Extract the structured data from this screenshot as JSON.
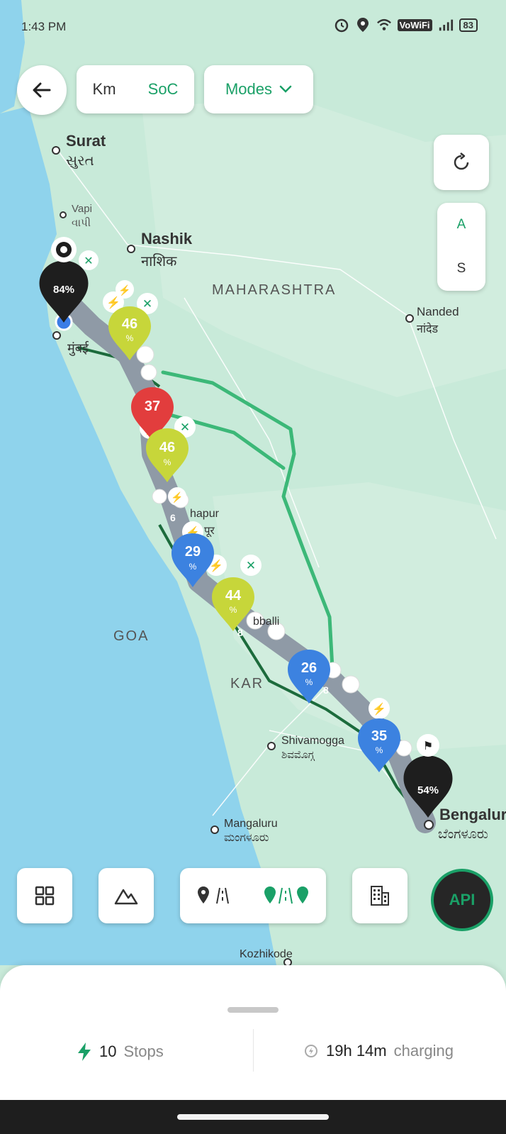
{
  "status_bar": {
    "time": "1:43 PM",
    "network": "VoWiFi",
    "battery": "83"
  },
  "top_controls": {
    "unit_km": "Km",
    "unit_soc": "SoC",
    "modes_label": "Modes",
    "side_a": "A",
    "side_s": "S"
  },
  "map": {
    "cities": {
      "surat": "Surat",
      "surat_local": "સુરત",
      "vapi": "Vapi",
      "vapi_local": "વાપી",
      "nashik": "Nashik",
      "nashik_local": "नाशिक",
      "mumbai_local": "मुंबई",
      "nanded": "Nanded",
      "nanded_local": "नांदेड",
      "kolhapur_partial": "hapur",
      "kolhapur_local_partial": "पूर",
      "hubballi_partial": "bballi",
      "shivamogga": "Shivamogga",
      "shivamogga_local": "ಶಿವಮೊಗ್ಗ",
      "mangaluru": "Mangaluru",
      "mangaluru_local": "ಮಂಗಳೂರು",
      "bengaluru": "Bengalur",
      "bengaluru_local": "ಬೆಂಗಳೂರು",
      "kozhikode": "Kozhikode"
    },
    "states": {
      "maharashtra": "MAHARASHTRA",
      "goa": "GOA",
      "karnataka_partial": "KAR"
    },
    "markers": {
      "start_soc": "84%",
      "stop_1": "46",
      "stop_2": "37",
      "stop_3": "46",
      "stop_4": "29",
      "stop_5": "44",
      "stop_6": "26",
      "stop_7": "35",
      "end_soc": "54%",
      "percent_sign": "%",
      "partial_6": "6",
      "partial_8a": "8",
      "partial_8b": "8"
    },
    "colors": {
      "water": "#8fd3ec",
      "land": "#bfe6d6",
      "route_main": "#8f9aa6",
      "route_alt": "#3cb878",
      "marker_black": "#1e1e1e",
      "marker_yellow": "#c7d63a",
      "marker_red": "#e23d3d",
      "marker_blue": "#3c82e0",
      "accent": "#1aa067"
    }
  },
  "bottom_bar": {
    "api_label": "API",
    "icons": [
      "grid-icon",
      "mountain-icon",
      "route-single-icon",
      "route-multi-icon",
      "building-icon"
    ]
  },
  "summary": {
    "stops_count": "10",
    "stops_label": "Stops",
    "charging_time": "19h 14m",
    "charging_label": "charging"
  }
}
